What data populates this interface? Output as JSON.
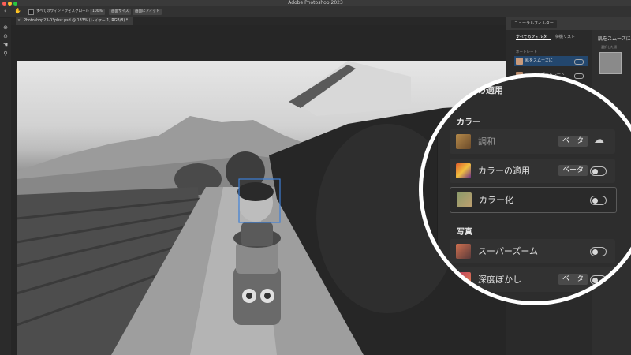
{
  "app": {
    "title": "Adobe Photoshop 2023"
  },
  "options_bar": {
    "scroll_all_label": "すべてのウィンドウをスクロール",
    "zoom_100": "100%",
    "fit_screen": "画面サイズ",
    "fill_screen": "画面にフィット"
  },
  "document": {
    "tab_label": "Photoshop23-03pbst.psd @ 183% (レイヤー 1, RGB/8) *"
  },
  "neural_filters": {
    "panel_tab": "ニューラルフィルター",
    "tabs": [
      "すべてのフィルター",
      "待機リスト"
    ],
    "section_portrait": "ポートレート",
    "items": [
      {
        "label": "肌をスムーズに"
      },
      {
        "label": "スマートポートレート"
      }
    ],
    "right_title": "肌をスムーズに",
    "right_sub": "選択した顔"
  },
  "zoom": {
    "partial_heading": "の適用",
    "section_color": "カラー",
    "section_photo": "写真",
    "beta_label": "ベータ",
    "rows": [
      {
        "label": "調和",
        "beta": true,
        "toggle": "cloud"
      },
      {
        "label": "カラーの適用",
        "beta": true,
        "toggle": "switch"
      },
      {
        "label": "カラー化",
        "beta": false,
        "toggle": "switch"
      },
      {
        "label": "スーパーズーム",
        "beta": false,
        "toggle": "switch"
      },
      {
        "label": "深度ぼかし",
        "beta": true,
        "toggle": "switch"
      }
    ]
  },
  "colors": {
    "selection_box": "#3d7fd6",
    "zoom_ring": "#ffffff",
    "panel_bg": "#2d2d2d"
  }
}
